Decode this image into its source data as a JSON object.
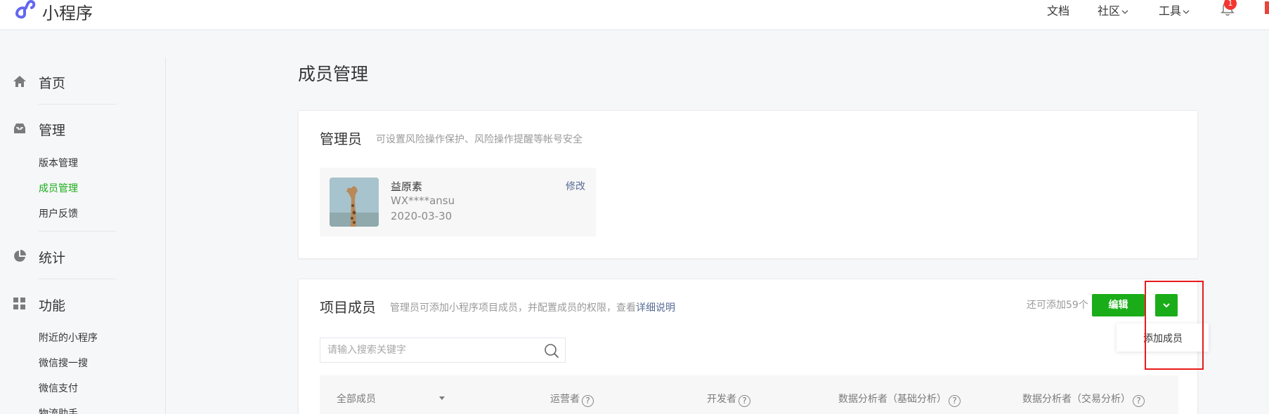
{
  "topbar": {
    "app_name": "小程序",
    "nav": {
      "docs": "文档",
      "community": "社区",
      "tools": "工具"
    },
    "notification_count": "1"
  },
  "sidebar": {
    "sections": [
      {
        "label": "首页",
        "icon": "home-icon"
      },
      {
        "label": "管理",
        "icon": "inbox-icon",
        "items": [
          "版本管理",
          "成员管理",
          "用户反馈"
        ],
        "active": "成员管理"
      },
      {
        "label": "统计",
        "icon": "pie-chart-icon"
      },
      {
        "label": "功能",
        "icon": "grid-icon",
        "items": [
          "附近的小程序",
          "微信搜一搜",
          "微信支付",
          "物流助手"
        ]
      }
    ]
  },
  "main": {
    "page_title": "成员管理",
    "admin_card": {
      "title": "管理员",
      "desc": "可设置风险操作保护、风险操作提醒等帐号安全",
      "admin": {
        "name": "益原素",
        "wx": "WX****ansu",
        "date": "2020-03-30",
        "modify": "修改"
      }
    },
    "members_card": {
      "title": "项目成员",
      "desc": "管理员可添加小程序项目成员，并配置成员的权限，查看",
      "desc_link": "详细说明",
      "remaining": "还可添加59个",
      "edit_label": "编辑",
      "dropdown_item": "添加成员",
      "search_placeholder": "请输入搜索关键字",
      "columns": [
        "全部成员",
        "运营者",
        "开发者",
        "数据分析者（基础分析）",
        "数据分析者（交易分析）"
      ]
    }
  },
  "colors": {
    "accent_green": "#1aad19",
    "link_blue": "#576b95",
    "highlight_red": "#e8191b",
    "badge_red": "#f43530"
  }
}
